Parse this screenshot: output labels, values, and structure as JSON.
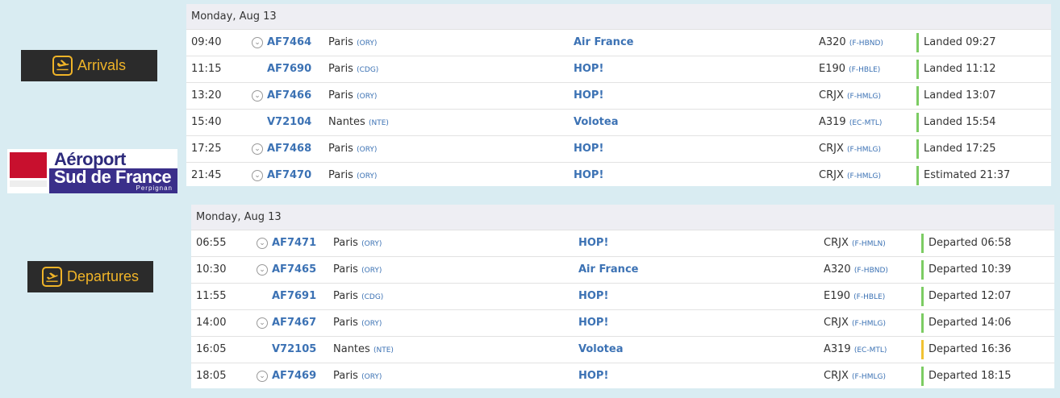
{
  "arrivals_label": "Arrivals",
  "departures_label": "Departures",
  "logo": {
    "line1": "Aéroport",
    "line2": "Sud de France",
    "line3": "Perpignan"
  },
  "colors": {
    "accent": "#f0b428",
    "status_ok": "#7ccc63",
    "status_warn": "#f1c232",
    "link": "#3c72b4"
  },
  "arrivals": {
    "date": "Monday, Aug 13",
    "rows": [
      {
        "time": "09:40",
        "chev": true,
        "flight": "AF7464",
        "city": "Paris",
        "code": "(ORY)",
        "airline": "Air France",
        "aircraft": "A320",
        "reg": "(F-HBND)",
        "status": "Landed 09:27",
        "status_color": "green"
      },
      {
        "time": "11:15",
        "chev": false,
        "flight": "AF7690",
        "city": "Paris",
        "code": "(CDG)",
        "airline": "HOP!",
        "aircraft": "E190",
        "reg": "(F-HBLE)",
        "status": "Landed 11:12",
        "status_color": "green"
      },
      {
        "time": "13:20",
        "chev": true,
        "flight": "AF7466",
        "city": "Paris",
        "code": "(ORY)",
        "airline": "HOP!",
        "aircraft": "CRJX",
        "reg": "(F-HMLG)",
        "status": "Landed 13:07",
        "status_color": "green"
      },
      {
        "time": "15:40",
        "chev": false,
        "flight": "V72104",
        "city": "Nantes",
        "code": "(NTE)",
        "airline": "Volotea",
        "aircraft": "A319",
        "reg": "(EC-MTL)",
        "status": "Landed 15:54",
        "status_color": "green"
      },
      {
        "time": "17:25",
        "chev": true,
        "flight": "AF7468",
        "city": "Paris",
        "code": "(ORY)",
        "airline": "HOP!",
        "aircraft": "CRJX",
        "reg": "(F-HMLG)",
        "status": "Landed 17:25",
        "status_color": "green"
      },
      {
        "time": "21:45",
        "chev": true,
        "flight": "AF7470",
        "city": "Paris",
        "code": "(ORY)",
        "airline": "HOP!",
        "aircraft": "CRJX",
        "reg": "(F-HMLG)",
        "status": "Estimated 21:37",
        "status_color": "green"
      }
    ]
  },
  "departures": {
    "date": "Monday, Aug 13",
    "rows": [
      {
        "time": "06:55",
        "chev": true,
        "flight": "AF7471",
        "city": "Paris",
        "code": "(ORY)",
        "airline": "HOP!",
        "aircraft": "CRJX",
        "reg": "(F-HMLN)",
        "status": "Departed 06:58",
        "status_color": "green"
      },
      {
        "time": "10:30",
        "chev": true,
        "flight": "AF7465",
        "city": "Paris",
        "code": "(ORY)",
        "airline": "Air France",
        "aircraft": "A320",
        "reg": "(F-HBND)",
        "status": "Departed 10:39",
        "status_color": "green"
      },
      {
        "time": "11:55",
        "chev": false,
        "flight": "AF7691",
        "city": "Paris",
        "code": "(CDG)",
        "airline": "HOP!",
        "aircraft": "E190",
        "reg": "(F-HBLE)",
        "status": "Departed 12:07",
        "status_color": "green"
      },
      {
        "time": "14:00",
        "chev": true,
        "flight": "AF7467",
        "city": "Paris",
        "code": "(ORY)",
        "airline": "HOP!",
        "aircraft": "CRJX",
        "reg": "(F-HMLG)",
        "status": "Departed 14:06",
        "status_color": "green"
      },
      {
        "time": "16:05",
        "chev": false,
        "flight": "V72105",
        "city": "Nantes",
        "code": "(NTE)",
        "airline": "Volotea",
        "aircraft": "A319",
        "reg": "(EC-MTL)",
        "status": "Departed 16:36",
        "status_color": "yellow"
      },
      {
        "time": "18:05",
        "chev": true,
        "flight": "AF7469",
        "city": "Paris",
        "code": "(ORY)",
        "airline": "HOP!",
        "aircraft": "CRJX",
        "reg": "(F-HMLG)",
        "status": "Departed 18:15",
        "status_color": "green"
      }
    ]
  }
}
